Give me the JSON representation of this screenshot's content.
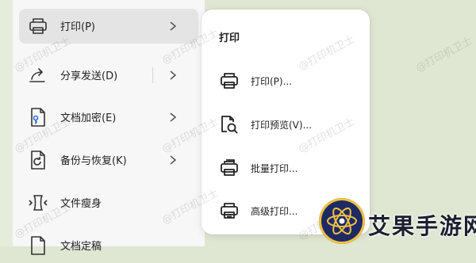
{
  "main_menu": {
    "items": [
      {
        "label": "打印(P)",
        "icon": "printer-icon"
      },
      {
        "label": "分享发送(D)",
        "icon": "share-icon"
      },
      {
        "label": "文档加密(E)",
        "icon": "document-lock-icon"
      },
      {
        "label": "备份与恢复(K)",
        "icon": "backup-icon"
      },
      {
        "label": "文件瘦身",
        "icon": "file-compress-icon"
      },
      {
        "label": "文档定稿",
        "icon": "document-final-icon"
      }
    ]
  },
  "submenu": {
    "title": "打印",
    "items": [
      {
        "label": "打印(P)...",
        "icon": "printer-icon"
      },
      {
        "label": "打印预览(V)...",
        "icon": "print-preview-icon"
      },
      {
        "label": "批量打印...",
        "icon": "batch-print-icon"
      },
      {
        "label": "高级打印...",
        "icon": "advanced-print-icon"
      }
    ]
  },
  "watermark_text": "@打印机卫士",
  "brand": {
    "logo_text": "艾果手游网",
    "primary": "#1e2a63",
    "accent": "#f0c244"
  },
  "colors": {
    "background": "#dfe6d2",
    "menu": "#f7f7f7",
    "active": "#e4e4e4"
  }
}
